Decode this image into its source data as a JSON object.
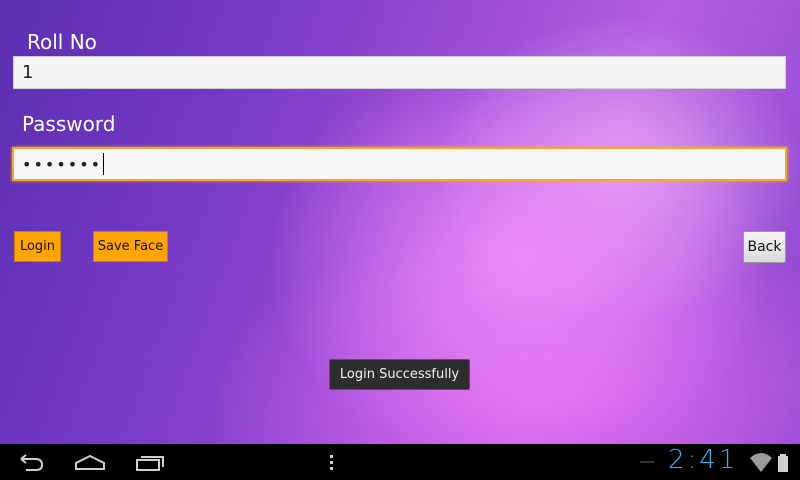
{
  "form": {
    "roll_label": "Roll No",
    "roll_value": "1",
    "password_label": "Password",
    "password_value": "•••••••"
  },
  "buttons": {
    "login": "Login",
    "save_face": "Save Face",
    "back": "Back"
  },
  "toast": {
    "message": "Login Successfully"
  },
  "system_bar": {
    "time": "2:41",
    "icons": [
      "back-icon",
      "home-icon",
      "recent-apps-icon",
      "menu-icon",
      "wifi-icon",
      "battery-icon"
    ]
  },
  "colors": {
    "button_orange": "#ffa500",
    "focus_border": "#f5a623",
    "clock_blue": "#35b5e5"
  }
}
